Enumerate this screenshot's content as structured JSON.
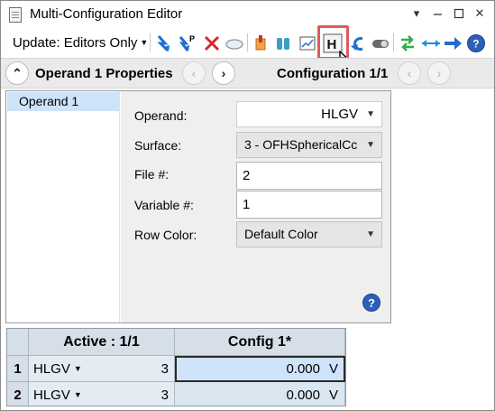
{
  "window": {
    "title": "Multi-Configuration Editor"
  },
  "window_controls": {
    "pin": "▾",
    "close": "✕"
  },
  "toolbar": {
    "update_label": "Update: Editors Only"
  },
  "nav": {
    "operand_label": "Operand  1 Properties",
    "config_label": "Configuration 1/1"
  },
  "properties": {
    "list_item": "Operand 1",
    "operand_label": "Operand:",
    "operand_value": "HLGV",
    "surface_label": "Surface:",
    "surface_value": "3 - OFHSphericalCc",
    "file_label": "File #:",
    "file_value": "2",
    "variable_label": "Variable #:",
    "variable_value": "1",
    "rowcolor_label": "Row Color:",
    "rowcolor_value": "Default Color"
  },
  "grid": {
    "header_active": "Active : 1/1",
    "header_config": "Config 1*",
    "rows": [
      {
        "num": "1",
        "operand": "HLGV",
        "param": "3",
        "value": "0.000",
        "solve": "V"
      },
      {
        "num": "2",
        "operand": "HLGV",
        "param": "3",
        "value": "0.000",
        "solve": "V"
      }
    ]
  },
  "colors": {
    "highlight": "#e05a5a",
    "grid_header": "#d6dee8",
    "selection": "#cde3f7"
  }
}
